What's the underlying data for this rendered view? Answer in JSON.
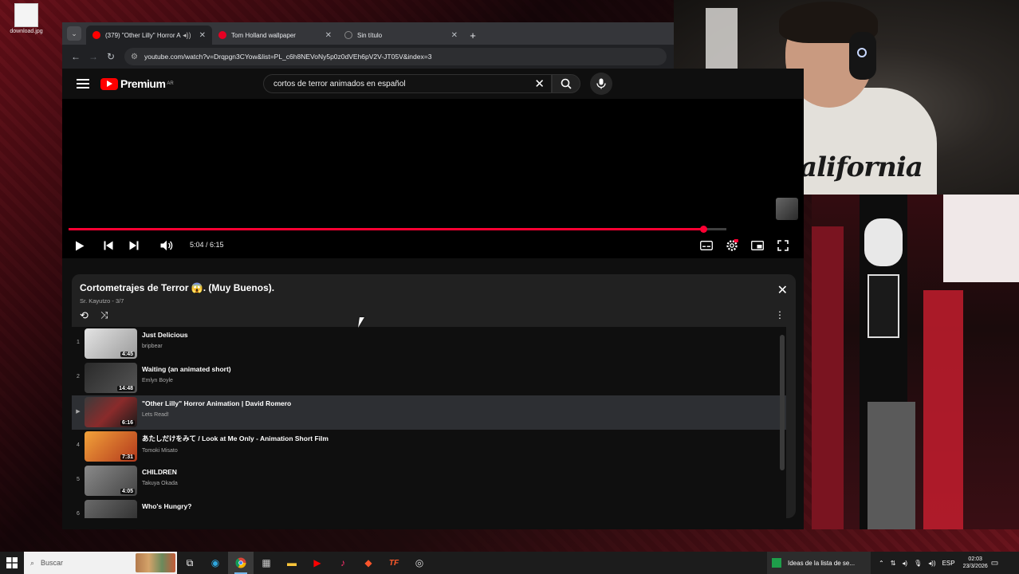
{
  "desktop": {
    "icon_label": "download.jpg"
  },
  "browser": {
    "tabs": [
      {
        "title": "(379) \"Other Lilly\" Horror A",
        "active": true,
        "favicon_color": "#ff0000"
      },
      {
        "title": "Tom Holland wallpaper",
        "active": false,
        "favicon_color": "#e60023"
      },
      {
        "title": "Sin título",
        "active": false,
        "favicon_color": "#777777"
      }
    ],
    "url": "youtube.com/watch?v=Drqpgn3CYow&list=PL_c6h8NEVoNy5p0z0dVEh6pV2V-JT05V&index=3"
  },
  "youtube": {
    "logo_text": "Premium",
    "logo_badge": "AR",
    "search_query": "cortos de terror animados en español",
    "player": {
      "time": "5:04 / 6:15",
      "progress_fraction": 0.965
    },
    "playlist": {
      "title": "Cortometrajes de Terror 😱. (Muy Buenos).",
      "subtitle": "Sr. Kayutzo - 3/7",
      "items": [
        {
          "index": "1",
          "title": "Just Delicious",
          "channel": "bripbear",
          "duration": "4:45",
          "current": false
        },
        {
          "index": "2",
          "title": "Waiting (an animated short)",
          "channel": "Emlyn Boyle",
          "duration": "14:48",
          "current": false
        },
        {
          "index": "▶",
          "title": "\"Other Lilly\" Horror Animation | David Romero",
          "channel": "Lets Read!",
          "duration": "6:16",
          "current": true
        },
        {
          "index": "4",
          "title": "あたしだけをみて / Look at Me Only - Animation Short Film",
          "channel": "Tomoki Misato",
          "duration": "7:31",
          "current": false
        },
        {
          "index": "5",
          "title": "CHILDREN",
          "channel": "Takuya Okada",
          "duration": "4:05",
          "current": false
        },
        {
          "index": "6",
          "title": "Who's Hungry?",
          "channel": "",
          "duration": "",
          "current": false
        }
      ]
    }
  },
  "taskbar": {
    "search_placeholder": "Buscar",
    "running_app": "Ideas de la lista de se...",
    "language": "ESP",
    "time": "02:03",
    "date": "23/3/2026"
  },
  "webcam": {
    "shirt_text": "California"
  },
  "colors": {
    "accent": "#ff0033",
    "background": "#0f0f0f"
  }
}
